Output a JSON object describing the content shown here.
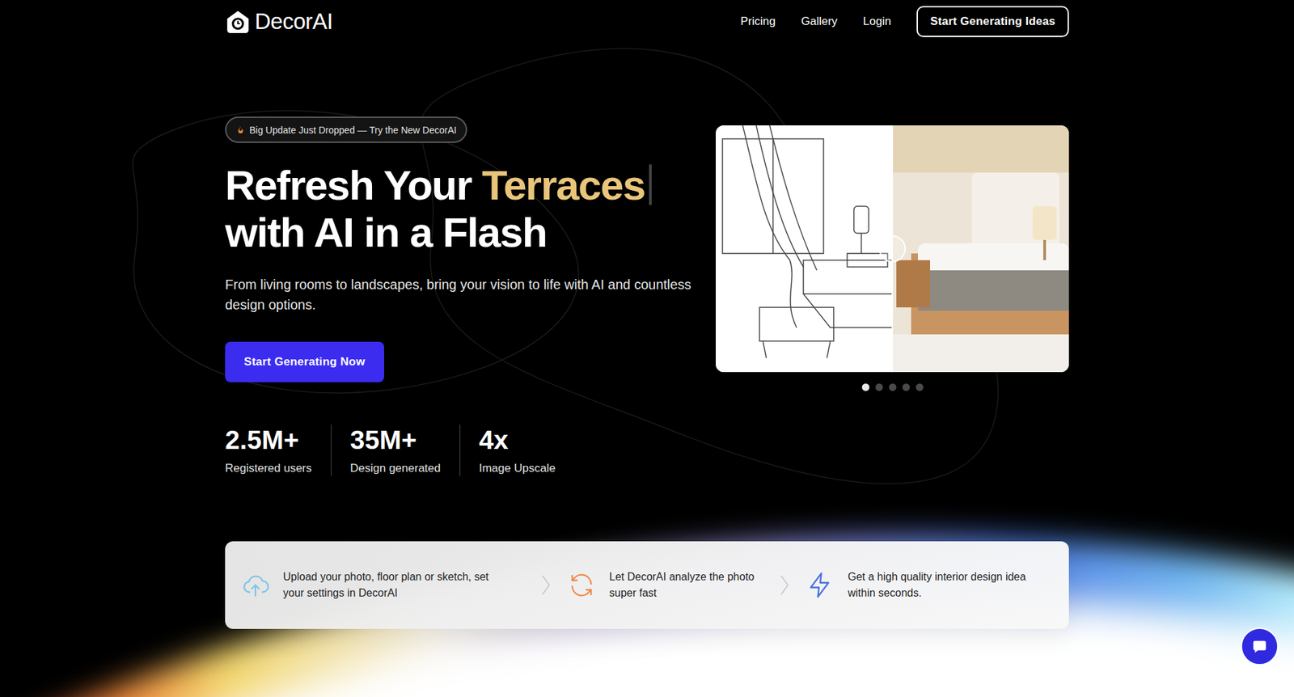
{
  "brand": {
    "name": "DecorAI"
  },
  "nav": {
    "links": [
      "Pricing",
      "Gallery",
      "Login"
    ],
    "cta": "Start Generating Ideas"
  },
  "hero": {
    "badge": "Big Update Just Dropped — Try the New DecorAI",
    "title_before": "Refresh Your",
    "title_highlight": "Terraces",
    "title_after": "with AI in a Flash",
    "subtitle": "From living rooms to landscapes, bring your vision to life with AI and countless design options.",
    "button": "Start Generating Now"
  },
  "stats": [
    {
      "value": "2.5M+",
      "label": "Registered users"
    },
    {
      "value": "35M+",
      "label": "Design generated"
    },
    {
      "value": "4x",
      "label": "Image Upscale"
    }
  ],
  "carousel": {
    "divider_level": 0.5,
    "slides": [
      {
        "selected": true
      },
      {
        "selected": false
      },
      {
        "selected": false
      },
      {
        "selected": false
      },
      {
        "selected": false
      }
    ]
  },
  "steps": [
    {
      "kind": "upload",
      "text": "Upload your photo, floor plan or sketch, set your settings in DecorAI",
      "color": "#7ec3e8"
    },
    {
      "kind": "refresh",
      "text": "Let DecorAI analyze the photo super fast",
      "color": "#f08a4b"
    },
    {
      "kind": "bolt",
      "text": "Get a high quality interior design idea within seconds.",
      "color": "#4a6fe0"
    }
  ]
}
